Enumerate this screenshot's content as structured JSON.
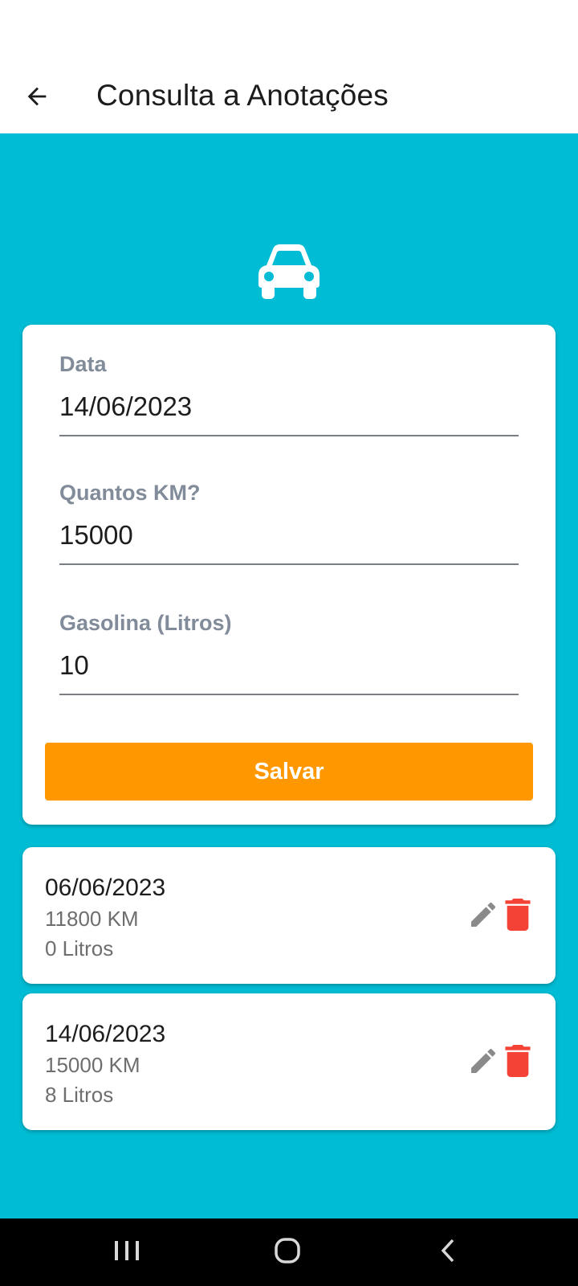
{
  "app_bar": {
    "title": "Consulta a Anotações",
    "back_icon": "arrow-left-icon"
  },
  "header_icon": "car-icon",
  "form": {
    "fields": [
      {
        "label": "Data",
        "value": "14/06/2023"
      },
      {
        "label": "Quantos KM?",
        "value": "15000"
      },
      {
        "label": "Gasolina (Litros)",
        "value": "10"
      }
    ],
    "save_label": "Salvar"
  },
  "entries": [
    {
      "date": "06/06/2023",
      "km": "11800 KM",
      "liters": "0 Litros"
    },
    {
      "date": "14/06/2023",
      "km": "15000 KM",
      "liters": "8 Litros"
    }
  ],
  "nav_bar": {
    "items": [
      "recent-apps-icon",
      "home-icon",
      "back-icon"
    ]
  },
  "colors": {
    "background": "#00bcd4",
    "primary_button": "#ff9800",
    "delete_icon": "#f44336",
    "edit_icon": "#8a8a8a"
  }
}
